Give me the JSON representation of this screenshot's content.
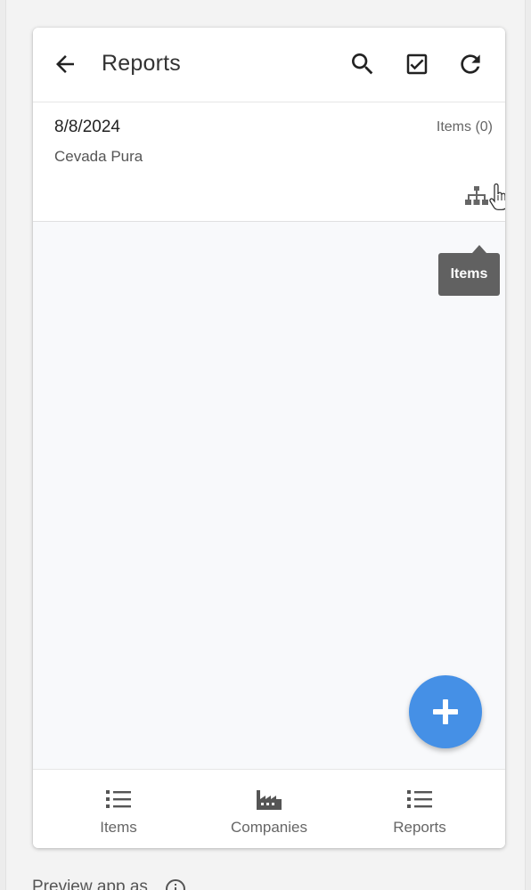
{
  "header": {
    "title": "Reports",
    "back_icon": "arrow-left-icon",
    "search_icon": "search-icon",
    "select_icon": "checkbox-icon",
    "refresh_icon": "refresh-icon"
  },
  "report": {
    "date": "8/8/2024",
    "company": "Cevada Pura",
    "items_count": "Items (0)",
    "hierarchy_icon": "sitemap-icon"
  },
  "tooltip": {
    "text": "Items"
  },
  "fab": {
    "icon": "plus-icon",
    "color": "#4590e6"
  },
  "bottom_nav": {
    "items": [
      {
        "label": "Items",
        "icon": "list-icon"
      },
      {
        "label": "Companies",
        "icon": "factory-icon"
      },
      {
        "label": "Reports",
        "icon": "list-icon"
      }
    ]
  },
  "footer": {
    "preview_text": "Preview app as",
    "info_icon": "info-icon"
  },
  "colors": {
    "accent": "#4590e6",
    "tooltip_bg": "#616161",
    "text_primary": "#333333",
    "text_secondary": "#666666"
  }
}
